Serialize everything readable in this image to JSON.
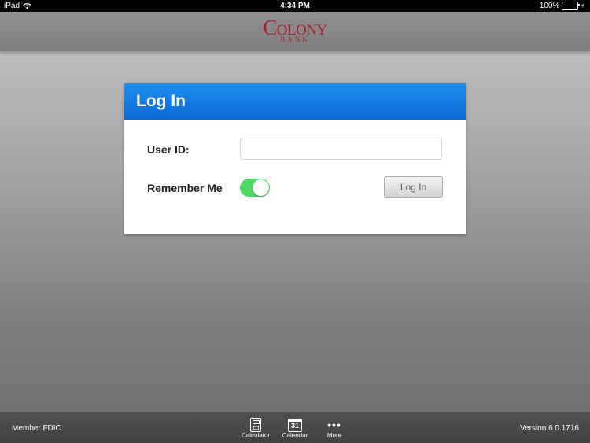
{
  "status_bar": {
    "device": "iPad",
    "time": "4:34 PM",
    "battery": "100%",
    "battery_level": 1.0
  },
  "header": {
    "logo_main": "Colony",
    "logo_sub": "BANK",
    "logo_color": "#a3202c"
  },
  "login": {
    "title": "Log In",
    "user_id_label": "User ID:",
    "user_id_value": "",
    "remember_label": "Remember Me",
    "remember_on": true,
    "button_label": "Log In",
    "accent_color": "#1f8ef0",
    "toggle_color": "#4cd964"
  },
  "toolbar": {
    "left_text": "Member FDIC",
    "right_text": "Version 6.0.1716",
    "items": [
      {
        "label": "Calculator",
        "icon": "calculator-icon"
      },
      {
        "label": "Calendar",
        "icon": "calendar-icon",
        "icon_text": "31"
      },
      {
        "label": "More",
        "icon": "more-icon"
      }
    ]
  }
}
